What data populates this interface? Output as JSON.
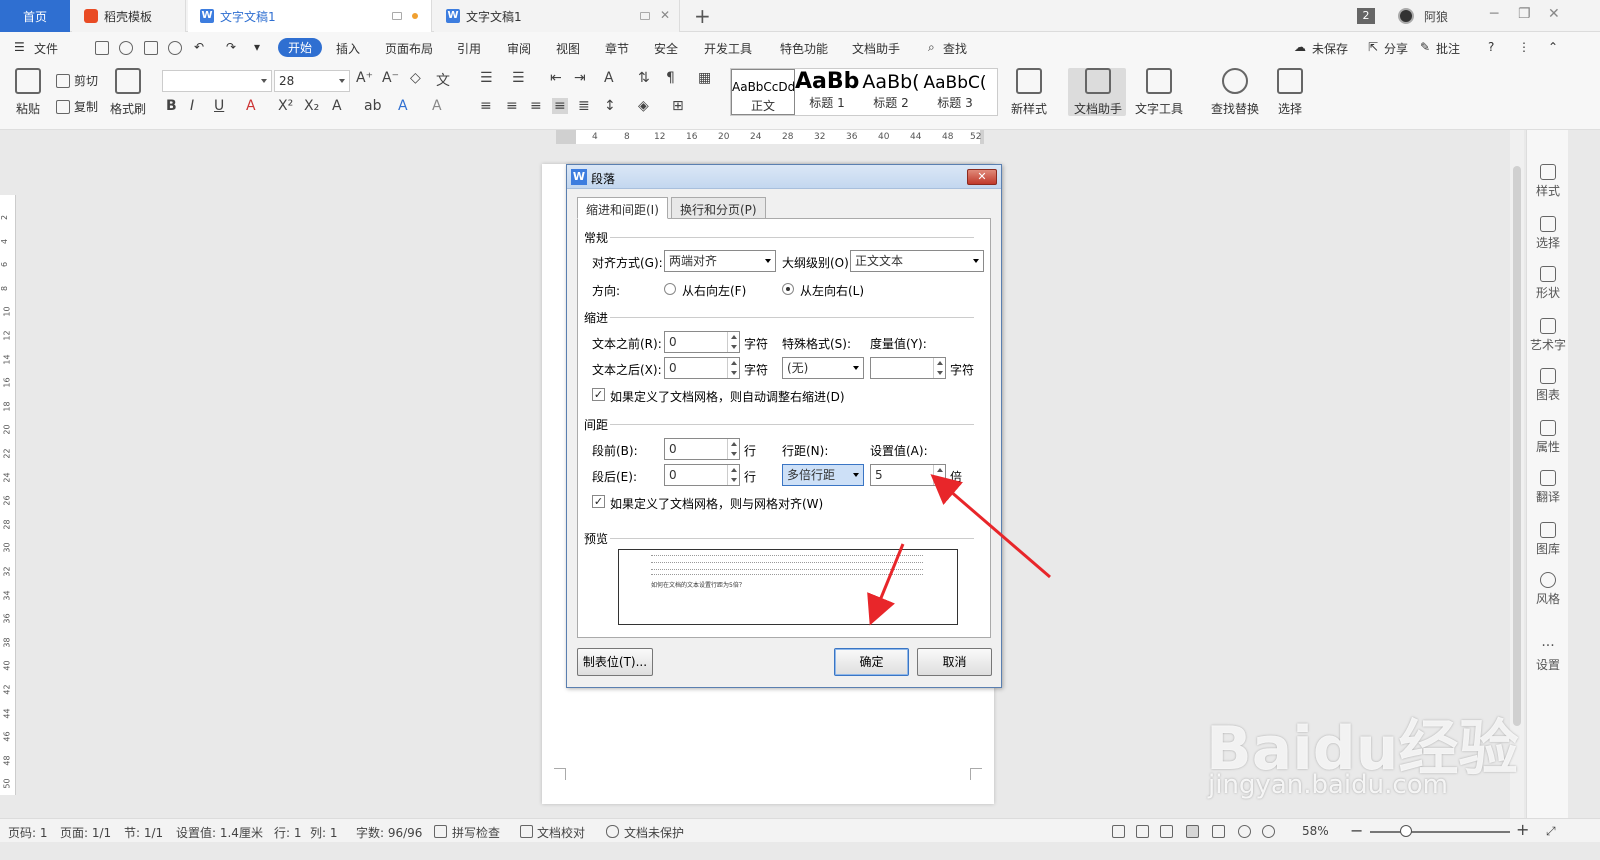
{
  "tabs": {
    "home": "首页",
    "daoke": "稻壳模板",
    "doc1": "文字文稿1",
    "doc2": "文字文稿1"
  },
  "window": {
    "count": "2",
    "user": "阿狼"
  },
  "menu": {
    "file": "文件",
    "items": [
      "开始",
      "插入",
      "页面布局",
      "引用",
      "审阅",
      "视图",
      "章节",
      "安全",
      "开发工具",
      "特色功能",
      "文档助手"
    ],
    "search": "查找",
    "unsaved": "未保存",
    "share": "分享",
    "comment": "批注"
  },
  "ribbon": {
    "paste": "粘贴",
    "cut": "剪切",
    "copy": "复制",
    "format_painter": "格式刷",
    "font_size": "28",
    "styles": [
      {
        "sample": "AaBbCcDd",
        "name": "正文"
      },
      {
        "sample": "AaBb",
        "name": "标题 1"
      },
      {
        "sample": "AaBb(",
        "name": "标题 2"
      },
      {
        "sample": "AaBbC(",
        "name": "标题 3"
      }
    ],
    "new_style": "新样式",
    "doc_helper": "文档助手",
    "text_tools": "文字工具",
    "find_replace": "查找替换",
    "select": "选择"
  },
  "ruler": {
    "h_ticks": [
      "4",
      "8",
      "12",
      "16",
      "20",
      "24",
      "28",
      "32",
      "36",
      "40",
      "44",
      "48",
      "52"
    ],
    "v_ticks": [
      "2",
      "4",
      "6",
      "8",
      "10",
      "12",
      "14",
      "16",
      "18",
      "20",
      "22",
      "24",
      "26",
      "28",
      "30",
      "32",
      "34",
      "36",
      "38",
      "40",
      "42",
      "44",
      "46",
      "48",
      "50"
    ]
  },
  "dialog": {
    "title": "段落",
    "tab_indent": "缩进和间距(I)",
    "tab_breaks": "换行和分页(P)",
    "general": "常规",
    "alignment_label": "对齐方式(G):",
    "alignment_value": "两端对齐",
    "outline_label": "大纲级别(O):",
    "outline_value": "正文文本",
    "direction_label": "方向:",
    "rtl": "从右向左(F)",
    "ltr": "从左向右(L)",
    "indent": "缩进",
    "before_text_label": "文本之前(R):",
    "before_text_value": "0",
    "after_text_label": "文本之后(X):",
    "after_text_value": "0",
    "unit_char": "字符",
    "special_label": "特殊格式(S):",
    "special_value": "(无)",
    "measure_label": "度量值(Y):",
    "measure_value": "",
    "auto_indent_check": "如果定义了文档网格，则自动调整右缩进(D)",
    "spacing": "间距",
    "before_label": "段前(B):",
    "before_value": "0",
    "after_label": "段后(E):",
    "after_value": "0",
    "unit_line": "行",
    "line_spacing_label": "行距(N):",
    "line_spacing_value": "多倍行距",
    "set_value_label": "设置值(A):",
    "set_value": "5",
    "unit_times": "倍",
    "grid_check": "如果定义了文档网格，则与网格对齐(W)",
    "preview": "预览",
    "preview_text": "如何在文档的文本设置行距为5倍？",
    "tabs_button": "制表位(T)...",
    "ok": "确定",
    "cancel": "取消"
  },
  "sidepane": [
    "样式",
    "选择",
    "形状",
    "艺术字",
    "图表",
    "属性",
    "翻译",
    "图库",
    "风格",
    "设置"
  ],
  "status": {
    "page_no": "页码: 1",
    "pages": "页面: 1/1",
    "section": "节: 1/1",
    "set_value": "设置值: 1.4厘米",
    "row": "行: 1",
    "col": "列: 1",
    "words": "字数: 96/96",
    "spell": "拼写检查",
    "proof": "文档校对",
    "protect": "文档未保护",
    "zoom": "58%"
  },
  "watermark": {
    "main": "Baidu经验",
    "sub": "jingyan.baidu.com"
  },
  "colors": {
    "accent": "#2f6fd1",
    "arrow": "#e8262a"
  }
}
